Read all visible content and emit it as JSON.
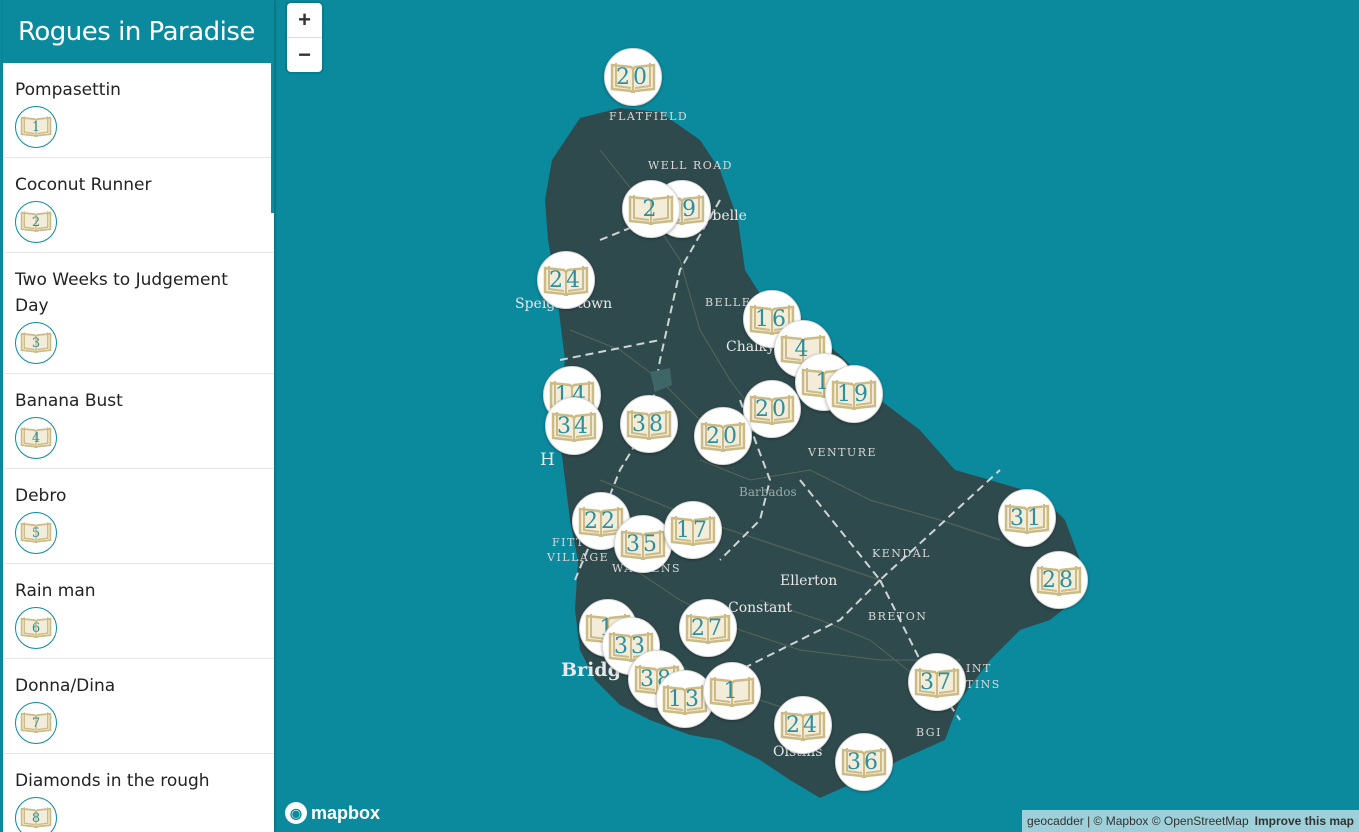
{
  "app_title": "Rogues in Paradise",
  "stories": [
    {
      "title": "Pompasettin",
      "num": "1"
    },
    {
      "title": "Coconut Runner",
      "num": "2"
    },
    {
      "title": "Two Weeks to Judgement Day",
      "num": "3"
    },
    {
      "title": "Banana Bust",
      "num": "4"
    },
    {
      "title": "Debro",
      "num": "5"
    },
    {
      "title": "Rain man",
      "num": "6"
    },
    {
      "title": "Donna/Dina",
      "num": "7"
    },
    {
      "title": "Diamonds in the rough",
      "num": "8"
    }
  ],
  "zoom": {
    "in_label": "+",
    "out_label": "−"
  },
  "places": [
    "FLATFIELD",
    "WELL ROAD",
    "BELLE",
    "VENTURE",
    "KENDAL",
    "BRETON",
    "FITT",
    "VILLAGE",
    "WALLENS",
    "INT",
    "TINS",
    "BGI"
  ],
  "towns": [
    "Speightstown",
    "obelle",
    "Chalky",
    "Barbados",
    "Ellerton",
    "Constant",
    "Bridg",
    "Oistins",
    "H"
  ],
  "markers": [
    "20",
    "29",
    "2",
    "24",
    "16",
    "4",
    "1",
    "19",
    "14",
    "34",
    "38",
    "20",
    "20",
    "22",
    "35",
    "17",
    "31",
    "28",
    "1",
    "33",
    "27",
    "38",
    "13",
    "1",
    "37",
    "24",
    "36"
  ],
  "logo_text": "mapbox",
  "attribution": {
    "text": "geocadder | © Mapbox © OpenStreetMap",
    "link": "Improve this map"
  },
  "colors": {
    "water": "#0b8a9e",
    "land": "#2f4a4d",
    "book": "#cdbb86",
    "number": "#2a8fa0"
  }
}
